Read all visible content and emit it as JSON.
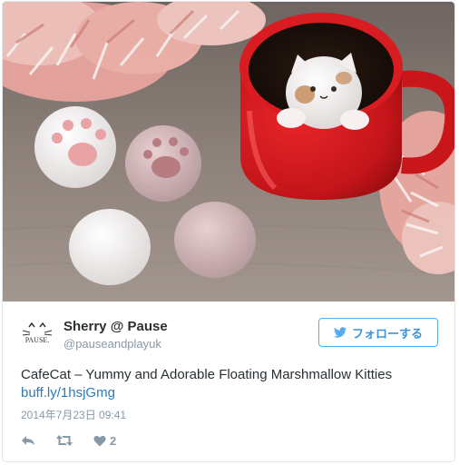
{
  "tweet": {
    "author": {
      "display_name": "Sherry @ Pause",
      "handle": "@pauseandplayuk",
      "avatar_text": "PAUSE."
    },
    "follow_label": "フォローする",
    "text": "CafeCat – Yummy and Adorable Floating Marshmallow Kitties",
    "link": "buff.ly/1hsjGmg",
    "timestamp": "2014年7月23日 09:41",
    "like_count": "2"
  },
  "icons": {
    "reply": "reply-icon",
    "retweet": "retweet-icon",
    "like": "heart-icon",
    "follow": "twitter-bird-icon"
  },
  "colors": {
    "accent": "#55acee",
    "link": "#2b7bb9",
    "muted": "#8899a6",
    "text": "#292f33"
  }
}
